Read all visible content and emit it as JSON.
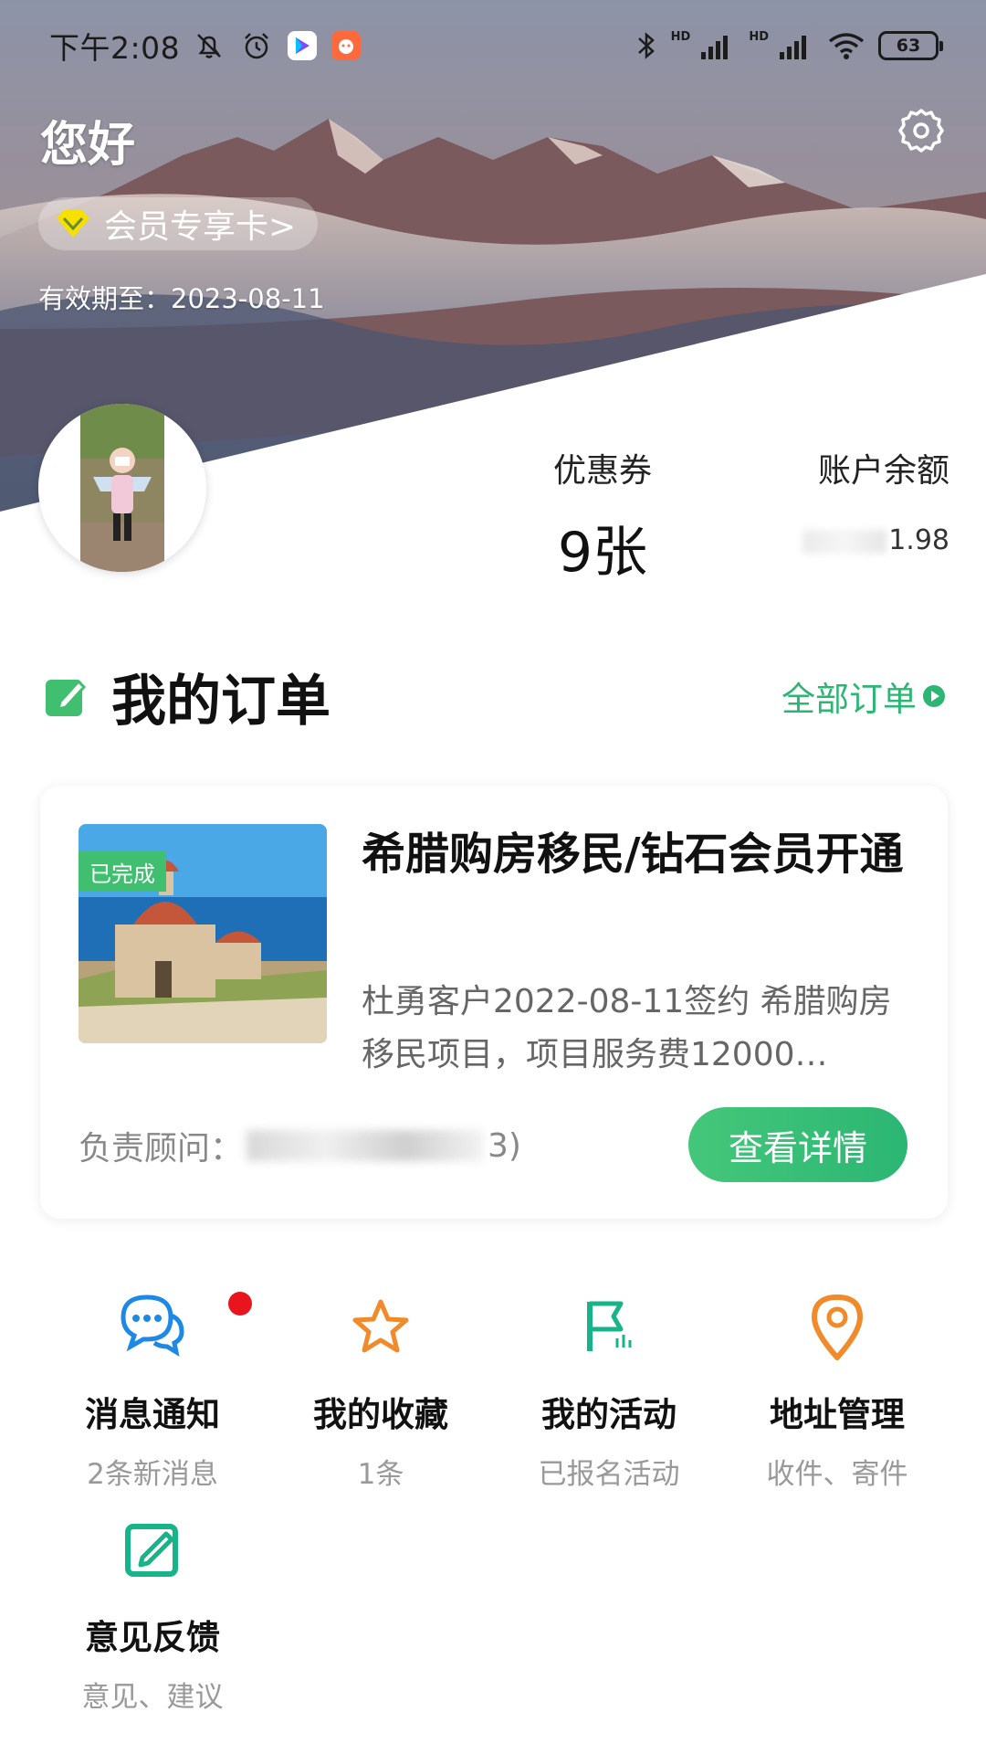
{
  "status_bar": {
    "time": "下午2:08",
    "battery": "63"
  },
  "header": {
    "greeting": "您好",
    "member_card": "会员专享卡>",
    "validity": "有效期至：2023-08-11"
  },
  "stats": {
    "coupons_label": "优惠券",
    "coupons_value": "9张",
    "balance_label": "账户余额",
    "balance_value_visible": "1.98"
  },
  "orders_section": {
    "title": "我的订单",
    "all_orders": "全部订单"
  },
  "order": {
    "status_tag": "已完成",
    "title": "希腊购房移民/钻石会员开通",
    "description": "杜勇客户2022-08-11签约 希腊购房移民项目，项目服务费12000…",
    "advisor_label": "负责顾问：",
    "advisor_tail": "3)",
    "detail_button": "查看详情"
  },
  "quick_actions": [
    {
      "label": "消息通知",
      "sub": "2条新消息",
      "icon": "chat-bubbles-icon"
    },
    {
      "label": "我的收藏",
      "sub": "1条",
      "icon": "star-icon"
    },
    {
      "label": "我的活动",
      "sub": "已报名活动",
      "icon": "flag-icon"
    },
    {
      "label": "地址管理",
      "sub": "收件、寄件",
      "icon": "location-pin-icon"
    },
    {
      "label": "意见反馈",
      "sub": "意见、建议",
      "icon": "edit-icon"
    }
  ],
  "colors": {
    "accent_green": "#2bb673",
    "blue_icon": "#1e88e5",
    "orange_icon": "#f08a2a",
    "teal_icon": "#17b48a",
    "red_dot": "#e8141e"
  }
}
